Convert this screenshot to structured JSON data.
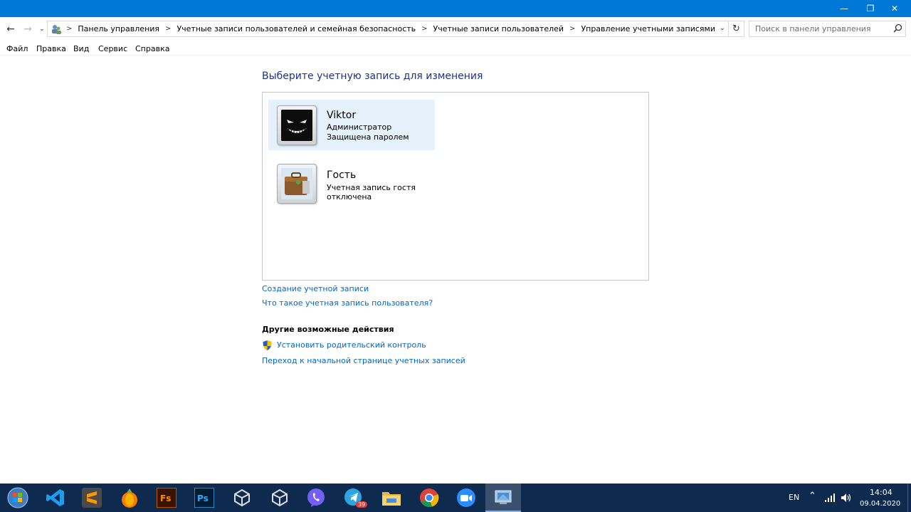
{
  "window": {
    "controls": {
      "minimize": "—",
      "maximize": "❐",
      "close": "✕"
    }
  },
  "addressbar": {
    "breadcrumbs": [
      "Панель управления",
      "Учетные записи пользователей и семейная безопасность",
      "Учетные записи пользователей",
      "Управление учетными записями"
    ],
    "separator": ">",
    "search_placeholder": "Поиск в панели управления"
  },
  "menu": [
    "Файл",
    "Правка",
    "Вид",
    "Сервис",
    "Справка"
  ],
  "main": {
    "heading": "Выберите учетную запись для изменения",
    "accounts": [
      {
        "name": "Viktor",
        "lines": [
          "Администратор",
          "Защищена паролем"
        ],
        "selected": true,
        "icon": "dark-grin-avatar"
      },
      {
        "name": "Гость",
        "lines": [
          "Учетная запись гостя отключена"
        ],
        "selected": false,
        "icon": "guest-briefcase-avatar"
      }
    ],
    "links": [
      "Создание учетной записи",
      "Что такое учетная запись пользователя?"
    ],
    "other_actions_heading": "Другие возможные действия",
    "other_actions": [
      "Установить родительский контроль",
      "Переход к начальной странице учетных записей"
    ]
  },
  "taskbar": {
    "apps": [
      "start",
      "vscode",
      "sublime-text",
      "fl-studio",
      "flash",
      "photoshop",
      "unity",
      "unity",
      "viber",
      "telegram",
      "file-explorer",
      "chrome",
      "zoom",
      "control-panel"
    ],
    "telegram_badge": "39",
    "language": "EN",
    "time": "14:04",
    "date": "09.04.2020"
  },
  "colors": {
    "titlebar": "#0078d7",
    "heading": "#1e3287",
    "link": "#0066cc",
    "selection": "#e5f1fb",
    "taskbar": "#0f2a4f"
  }
}
